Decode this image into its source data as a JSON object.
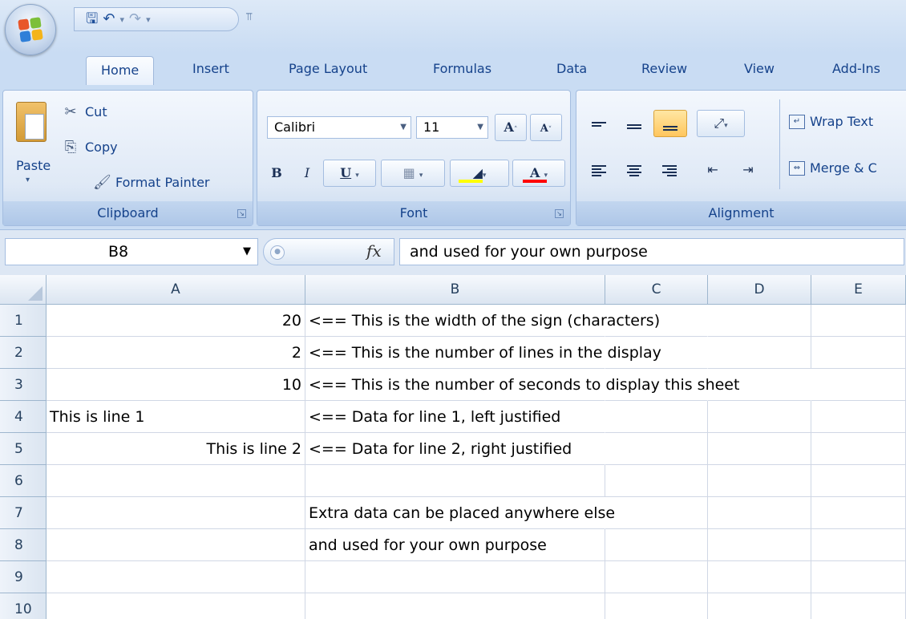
{
  "tabs": [
    "Home",
    "Insert",
    "Page Layout",
    "Formulas",
    "Data",
    "Review",
    "View",
    "Add-Ins"
  ],
  "ribbon": {
    "clipboard": {
      "paste": "Paste",
      "cut": "Cut",
      "copy": "Copy",
      "format_painter": "Format Painter",
      "label": "Clipboard"
    },
    "font": {
      "name": "Calibri",
      "size": "11",
      "label": "Font"
    },
    "alignment": {
      "wrap_text": "Wrap Text",
      "merge": "Merge & C",
      "label": "Alignment"
    }
  },
  "formula_bar": {
    "name_box": "B8",
    "fx": "fx",
    "formula": "and used for your own purpose"
  },
  "columns": [
    "A",
    "B",
    "C",
    "D",
    "E"
  ],
  "rows": [
    {
      "n": "1",
      "a": "20",
      "b": "<== This is the width of the sign (characters)"
    },
    {
      "n": "2",
      "a": "2",
      "b": "<== This is the number of lines in the display"
    },
    {
      "n": "3",
      "a": "10",
      "b": "<== This is the number of seconds to display this sheet"
    },
    {
      "n": "4",
      "a": "This is line 1",
      "b": "<== Data for line 1, left justified"
    },
    {
      "n": "5",
      "a": "This is line 2",
      "b": "<== Data for line 2, right justified"
    },
    {
      "n": "6",
      "a": "",
      "b": ""
    },
    {
      "n": "7",
      "a": "",
      "b": "Extra data can be placed anywhere else"
    },
    {
      "n": "8",
      "a": "",
      "b": "and used for your own purpose"
    },
    {
      "n": "9",
      "a": "",
      "b": ""
    },
    {
      "n": "10",
      "a": "",
      "b": ""
    }
  ],
  "colors": {
    "ribbon_bg": "#c9dcf3",
    "highlight": "#ffc65e",
    "fill_color": "#ffff00",
    "font_color": "#ff0000"
  }
}
